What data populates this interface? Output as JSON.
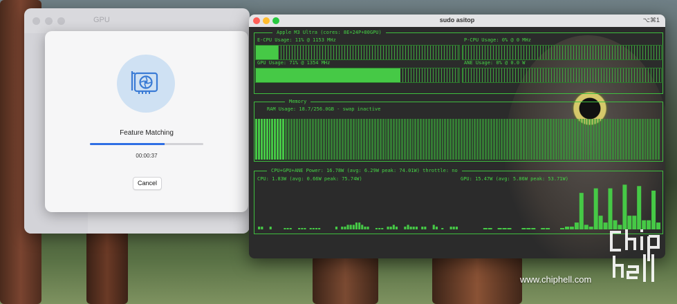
{
  "desktop": {
    "watermark": "www.chiphell.com"
  },
  "gpu_app": {
    "title": "GPU",
    "task": "Feature Matching",
    "progress": 0.66,
    "elapsed": "00:00:37",
    "cancel_label": "Cancel",
    "accent": "#2f6fe4",
    "icon": "gpu-card-icon"
  },
  "terminal": {
    "title": "sudo asitop",
    "shortcut": "⌥⌘1",
    "processor_panel": {
      "title": "Apple M3 Ultra (cores: 8E+24P+80GPU)",
      "ecpu_label": "E-CPU Usage: 11% @ 1153 MHz",
      "ecpu_usage": 0.11,
      "pcpu_label": "P-CPU Usage: 0% @ 0 MHz",
      "pcpu_usage": 0,
      "gpu_label": "GPU Usage: 71% @ 1354 MHz",
      "gpu_usage": 0.71,
      "ane_label": "ANE Usage: 0% @ 0.0 W",
      "ane_usage": 0
    },
    "memory_panel": {
      "title": "Memory",
      "ram_label": "RAM Usage: 18.7/256.0GB - swap inactive",
      "ram_history": [
        0.89,
        0.89,
        0.89,
        0.89,
        0.89,
        0.89,
        0.89,
        0.89,
        0.89,
        0.89,
        0.89,
        0.89,
        0.89,
        0.89,
        0.89,
        0.89,
        0.89,
        0.89,
        0.89,
        0.89,
        0.89,
        0.89,
        0.89,
        0.89,
        0.89,
        0.89,
        0.89,
        0.89,
        0.89,
        0.89,
        0.89,
        0.89,
        0.89,
        0.89,
        0.89,
        0.89,
        0.89,
        0.89,
        0.89,
        0.89,
        0.89,
        0.89,
        0.89,
        0.89,
        0.89,
        0.89,
        0.89,
        0.89,
        0.89,
        0.89,
        0.89,
        0.89,
        0.89,
        0.89,
        0.89,
        0.89,
        0.89,
        0.89,
        0.89,
        0.89,
        0.89,
        0.89,
        0.89,
        0.89,
        0.89,
        0.89,
        0.89,
        0.89,
        0.89,
        0.89,
        0.89,
        0.89,
        0.89,
        0.89,
        0.89,
        0.89,
        0.89,
        0.89,
        0.89,
        0.89,
        0.89,
        0.89,
        0.89,
        0.89,
        0.89,
        0.89,
        0.89,
        0.89,
        0.89,
        0.89,
        0.89,
        0.89,
        0.89,
        0.89,
        0.89,
        0.89,
        0.89,
        0.89,
        0.89,
        0.89,
        0.89,
        0.89,
        0.89,
        0.89,
        0.89,
        0.89,
        0.89,
        0.89,
        0.89,
        0.89,
        0.89,
        0.89,
        0.89,
        0.89,
        0.89,
        0.89,
        0.89,
        0.89,
        0.89,
        0.89,
        0.89,
        0.89,
        0.89,
        0.89,
        0.89,
        0.89,
        0.89,
        0.89,
        0.89,
        0.89,
        0.89,
        0.89,
        0.89,
        0.89,
        0.89,
        0.89,
        0.89,
        0.89,
        0.89,
        0.89,
        0.89,
        0.89,
        0.89,
        0.89,
        0.89,
        0.89,
        0.89,
        0.89,
        0.89,
        0.89
      ],
      "ram_recent_filled": 11
    },
    "power_panel": {
      "title": "CPU+GPU+ANE Power: 16.78W (avg: 6.29W peak: 74.01W) throttle: no",
      "cpu_label": "CPU: 1.83W (avg: 0.66W peak: 75.74W)",
      "gpu_label": "GPU: 15.47W (avg: 5.86W peak: 53.71W)",
      "cpu_history": [
        0,
        0.06,
        0.06,
        0,
        0,
        0.06,
        0,
        0,
        0,
        0,
        0.03,
        0.03,
        0.03,
        0,
        0,
        0.03,
        0.03,
        0.03,
        0,
        0.03,
        0.03,
        0.03,
        0.03,
        0,
        0,
        0,
        0,
        0,
        0.06,
        0,
        0.06,
        0.06,
        0.1,
        0.1,
        0.1,
        0.15,
        0.15,
        0.1,
        0.06,
        0.06,
        0,
        0,
        0.03,
        0.03,
        0.03,
        0,
        0.06,
        0.06,
        0.1,
        0.06,
        0,
        0,
        0.06,
        0.1,
        0.06,
        0.06,
        0.06,
        0,
        0.06,
        0.06,
        0,
        0,
        0.1,
        0.06,
        0,
        0.03,
        0,
        0,
        0.06,
        0.06,
        0.06
      ],
      "gpu_history": [
        0,
        0,
        0,
        0,
        0,
        0.03,
        0.03,
        0,
        0.03,
        0.03,
        0.03,
        0,
        0,
        0.03,
        0.03,
        0.03,
        0,
        0.03,
        0.03,
        0,
        0,
        0.03,
        0.06,
        0.06,
        0.15,
        0.8,
        0.1,
        0.06,
        0.9,
        0.3,
        0.15,
        0.9,
        0.2,
        0.1,
        0.98,
        0.3,
        0.3,
        0.95,
        0.2,
        0.2,
        0.85,
        0.15
      ]
    },
    "colors": {
      "green": "#45d445",
      "bar": "#46c946",
      "bg": "#2b2b2b"
    }
  }
}
